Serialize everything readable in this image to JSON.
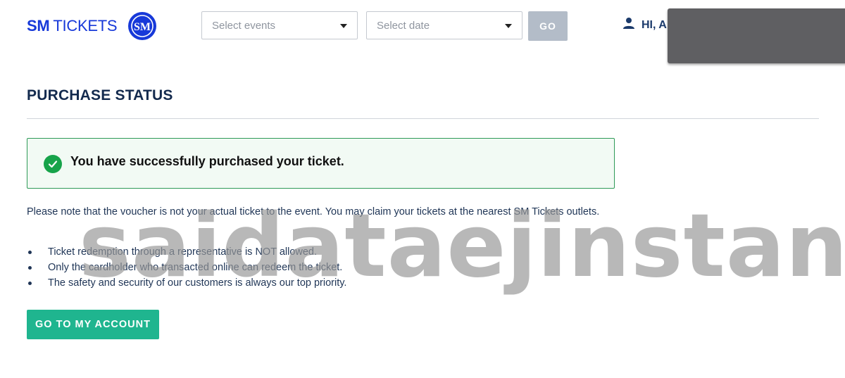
{
  "header": {
    "brand_bold": "SM",
    "brand_light": "TICKETS",
    "logo_text": "SM",
    "events_select": {
      "placeholder": "Select events"
    },
    "date_select": {
      "placeholder": "Select date"
    },
    "go_label": "GO",
    "user_greeting": "HI, A"
  },
  "main": {
    "title": "PURCHASE STATUS",
    "success_message": "You have successfully purchased your ticket.",
    "note": "Please note that the voucher is not your actual ticket to the event. You may claim your tickets at the nearest SM Tickets outlets.",
    "rules": [
      "Ticket redemption through a representative is NOT allowed.",
      "Only the cardholder who transacted online can redeem the ticket.",
      "The safety and security of our customers is always our top priority."
    ],
    "account_button": "GO TO MY ACCOUNT"
  },
  "watermark": "saidataejinstan",
  "colors": {
    "brand_blue": "#1739d9",
    "success_green": "#17a34a",
    "accent_teal": "#1fb58f",
    "go_disabled": "#b3bcc8"
  },
  "icons": [
    "sm-logo",
    "user-icon",
    "chevron-down-icon",
    "check-circle-icon"
  ]
}
